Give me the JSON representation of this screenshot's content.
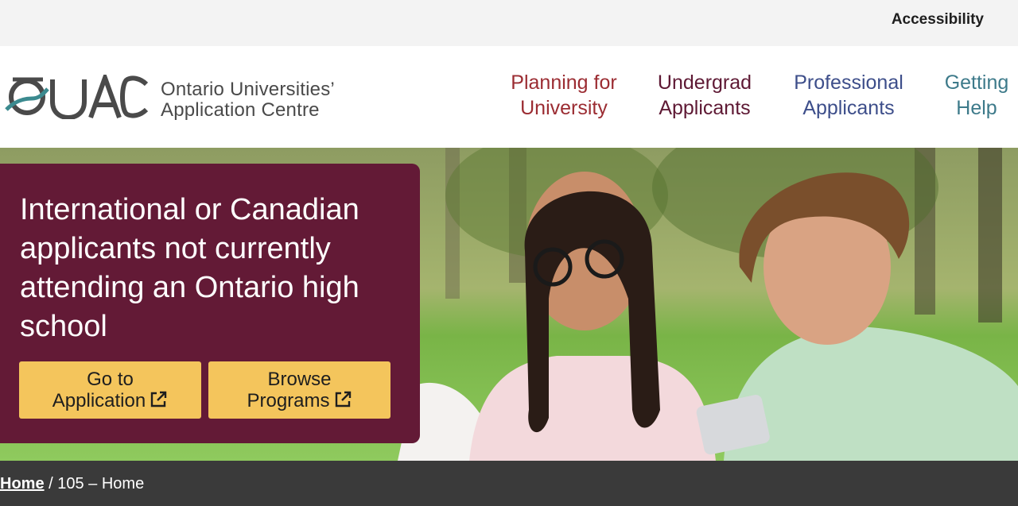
{
  "utility": {
    "accessibility": "Accessibility"
  },
  "brand": {
    "logo_text": "OUAC",
    "name_line1": "Ontario Universities’",
    "name_line2": "Application Centre"
  },
  "nav": {
    "planning": {
      "line1": "Planning for",
      "line2": "University",
      "color": "#9b2c32"
    },
    "undergrad": {
      "line1": "Undergrad",
      "line2": "Applicants",
      "color": "#5e1934"
    },
    "professional": {
      "line1": "Professional",
      "line2": "Applicants",
      "color": "#3d4e8a"
    },
    "help": {
      "line1": "Getting",
      "line2": "Help",
      "color": "#3d7a8a"
    }
  },
  "hero": {
    "heading": "International or Canadian applicants not currently attending an Ontario high school",
    "panel_color": "#631a36",
    "buttons": [
      {
        "line1": "Go to",
        "line2": "Application",
        "icon": "external-link-icon"
      },
      {
        "line1": "Browse",
        "line2": "Programs",
        "icon": "external-link-icon"
      }
    ],
    "button_color": "#f4c55c"
  },
  "breadcrumb": {
    "home": "Home",
    "separator": " / ",
    "current": "105 – Home"
  }
}
